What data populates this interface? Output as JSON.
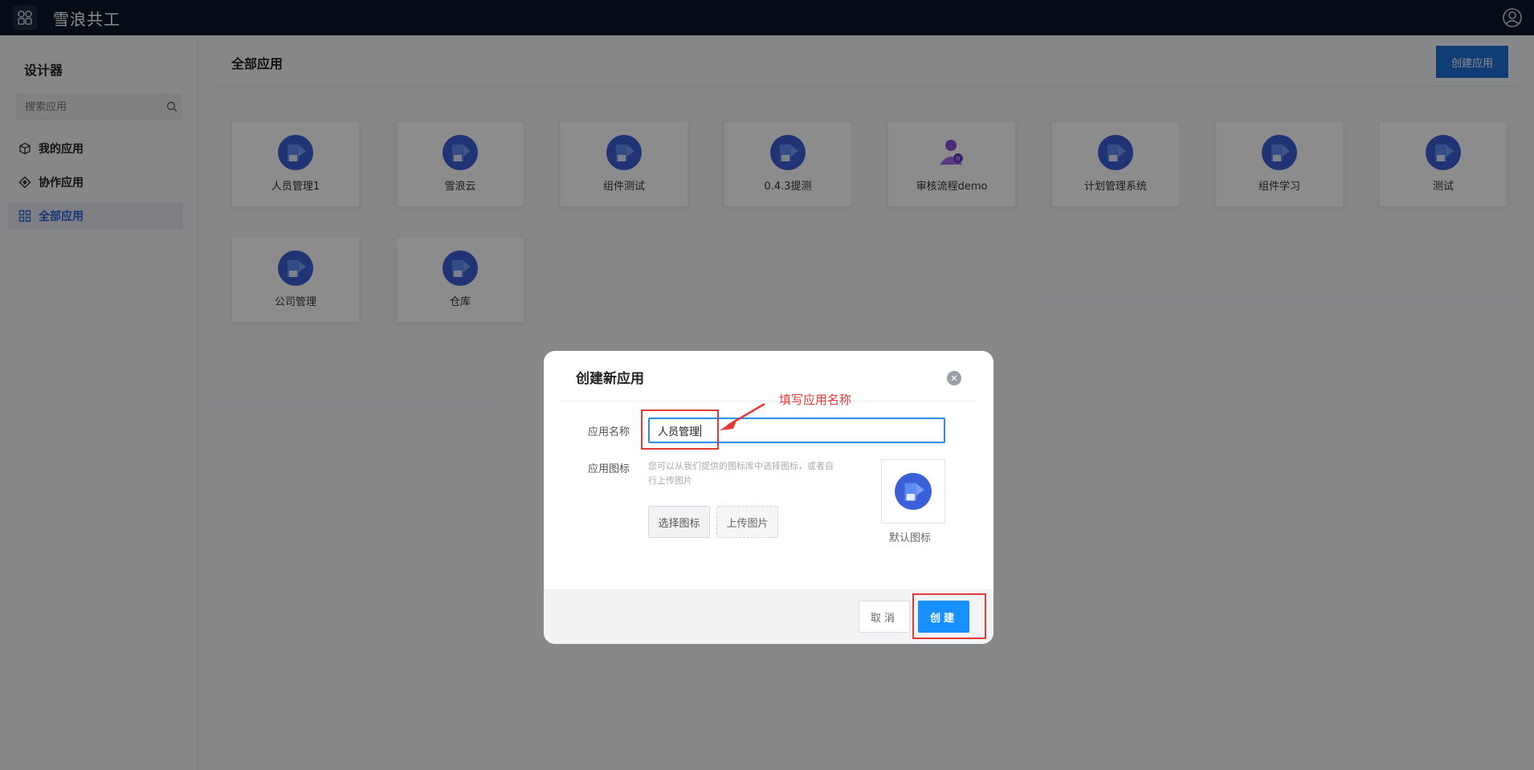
{
  "topbar": {
    "brand": "雪浪共工",
    "app_switch_icon": "grid-icon",
    "user_icon": "user-circle-icon"
  },
  "sidebar": {
    "title": "设计器",
    "search_placeholder": "搜索应用",
    "items": [
      {
        "label": "我的应用",
        "icon": "cube-icon",
        "active": false
      },
      {
        "label": "协作应用",
        "icon": "diamond-icon",
        "active": false
      },
      {
        "label": "全部应用",
        "icon": "grid-icon",
        "active": true
      }
    ]
  },
  "main": {
    "title": "全部应用",
    "create_button": "创建应用",
    "apps": [
      {
        "name": "人员管理1",
        "icon": "app-default-icon"
      },
      {
        "name": "雪浪云",
        "icon": "app-default-icon"
      },
      {
        "name": "组件测试",
        "icon": "app-default-icon"
      },
      {
        "name": "0.4.3提测",
        "icon": "app-default-icon"
      },
      {
        "name": "审核流程demo",
        "icon": "user-badge-icon"
      },
      {
        "name": "计划管理系统",
        "icon": "app-default-icon"
      },
      {
        "name": "组件学习",
        "icon": "app-default-icon"
      },
      {
        "name": "测试",
        "icon": "app-default-icon"
      },
      {
        "name": "公司管理",
        "icon": "app-default-icon"
      },
      {
        "name": "仓库",
        "icon": "app-default-icon"
      }
    ]
  },
  "modal": {
    "title": "创建新应用",
    "name_label": "应用名称",
    "name_value": "人员管理",
    "icon_label": "应用图标",
    "icon_hint": "您可以从我们提供的图标库中选择图标，或者自行上传图片",
    "choose_icon": "选择图标",
    "upload_image": "上传图片",
    "default_icon_label": "默认图标",
    "cancel": "取消",
    "create": "创建"
  },
  "annotation": {
    "text": "填写应用名称",
    "color": "#e53935"
  },
  "colors": {
    "topbar": "#0a1628",
    "primary": "#1890ff",
    "accent": "#1f6fd6"
  }
}
